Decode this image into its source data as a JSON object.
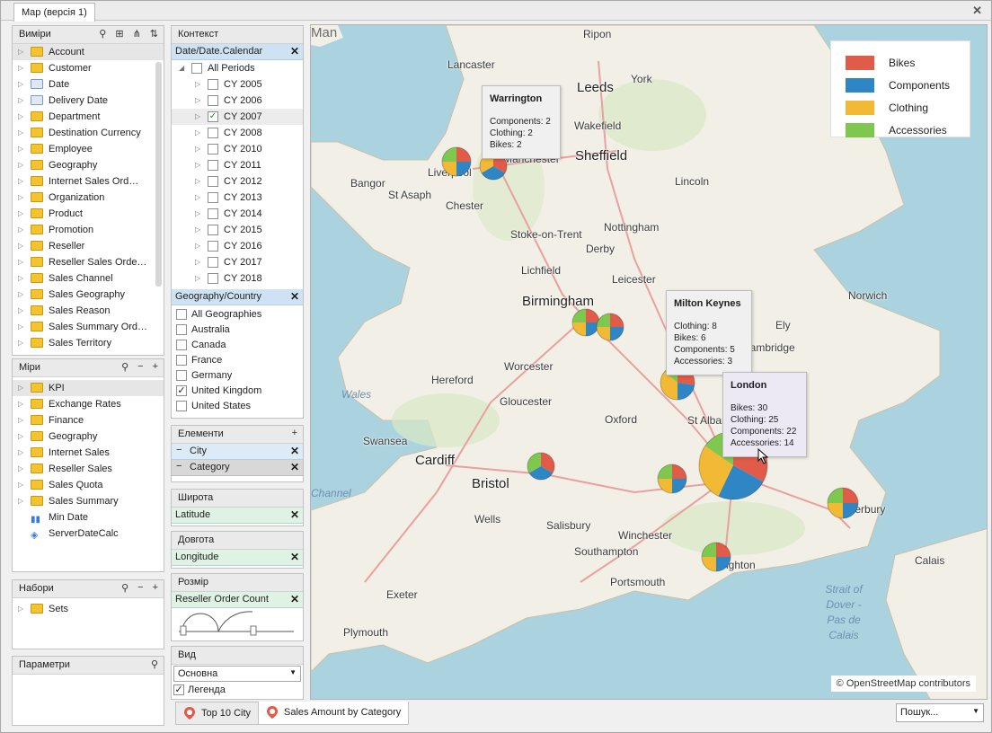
{
  "window": {
    "tab_title": "Map (версія 1)"
  },
  "dimensions": {
    "title": "Виміри",
    "items": [
      "Account",
      "Customer",
      "Date",
      "Delivery Date",
      "Department",
      "Destination Currency",
      "Employee",
      "Geography",
      "Internet Sales Ord…",
      "Organization",
      "Product",
      "Promotion",
      "Reseller",
      "Reseller Sales Orde…",
      "Sales Channel",
      "Sales Geography",
      "Sales Reason",
      "Sales Summary Ord…",
      "Sales Territory"
    ]
  },
  "measures": {
    "title": "Міри",
    "items": [
      "KPI",
      "Exchange Rates",
      "Finance",
      "Geography",
      "Internet Sales",
      "Reseller Sales",
      "Sales Quota",
      "Sales Summary",
      "Min Date",
      "ServerDateCalc"
    ]
  },
  "sets": {
    "title": "Набори",
    "items": [
      "Sets"
    ]
  },
  "params": {
    "title": "Параметри"
  },
  "context": {
    "title": "Контекст",
    "filter1": "Date/Date.Calendar",
    "all_periods": "All Periods",
    "years": [
      "CY 2005",
      "CY 2006",
      "CY 2007",
      "CY 2008",
      "CY 2010",
      "CY 2011",
      "CY 2012",
      "CY 2013",
      "CY 2014",
      "CY 2015",
      "CY 2016",
      "CY 2017",
      "CY 2018"
    ],
    "checked_year": "CY 2007",
    "filter2": "Geography/Country",
    "countries": [
      "All Geographies",
      "Australia",
      "Canada",
      "France",
      "Germany",
      "United Kingdom",
      "United States"
    ],
    "checked_country": "United Kingdom"
  },
  "elements": {
    "title": "Елементи",
    "items": [
      "City",
      "Category"
    ]
  },
  "latitude": {
    "title": "Широта",
    "value": "Latitude"
  },
  "longitude": {
    "title": "Довгота",
    "value": "Longitude"
  },
  "size": {
    "title": "Розмір",
    "value": "Reseller Order Count"
  },
  "view": {
    "title": "Вид",
    "select": "Основна",
    "legend_label": "Легенда"
  },
  "map": {
    "legend": [
      {
        "label": "Bikes",
        "color": "#e05b48"
      },
      {
        "label": "Components",
        "color": "#2f86c4"
      },
      {
        "label": "Clothing",
        "color": "#f2b934"
      },
      {
        "label": "Accessories",
        "color": "#7ec850"
      }
    ],
    "cities": [
      "Man",
      "Lancaster",
      "Ripon",
      "York",
      "Leeds",
      "Wakefield",
      "Sheffield",
      "Bangor",
      "St Asaph",
      "Chester",
      "Lincoln",
      "Nottingham",
      "Stoke-on-Trent",
      "Derby",
      "Lichfield",
      "Leicester",
      "Birmingham",
      "Norwich",
      "Ely",
      "Worcester",
      "Hereford",
      "Gloucester",
      "Oxford",
      "St Albans",
      "Swansea",
      "Cardiff",
      "Bristol",
      "Wells",
      "Salisbury",
      "Winchester",
      "Southampton",
      "Portsmouth",
      "Exeter",
      "Plymouth",
      "Calais",
      "Liverpool",
      "Manchester",
      "Cambridge",
      "Canterbury",
      "Brighton",
      "Wales",
      "Channel",
      "Strait of Dover - Pas de Calais"
    ],
    "tooltips": [
      {
        "title": "Warrington",
        "lines": [
          "Components: 2",
          "Clothing: 2",
          "Bikes: 2"
        ]
      },
      {
        "title": "Milton Keynes",
        "lines": [
          "Clothing: 8",
          "Bikes: 6",
          "Components: 5",
          "Accessories: 3"
        ]
      },
      {
        "title": "London",
        "lines": [
          "Bikes: 30",
          "Clothing: 25",
          "Components: 22",
          "Accessories: 14"
        ]
      }
    ],
    "attribution": "© OpenStreetMap contributors"
  },
  "bottom_tabs": [
    "Top 10 City",
    "Sales Amount by Category"
  ],
  "search_placeholder": "Пошук..."
}
